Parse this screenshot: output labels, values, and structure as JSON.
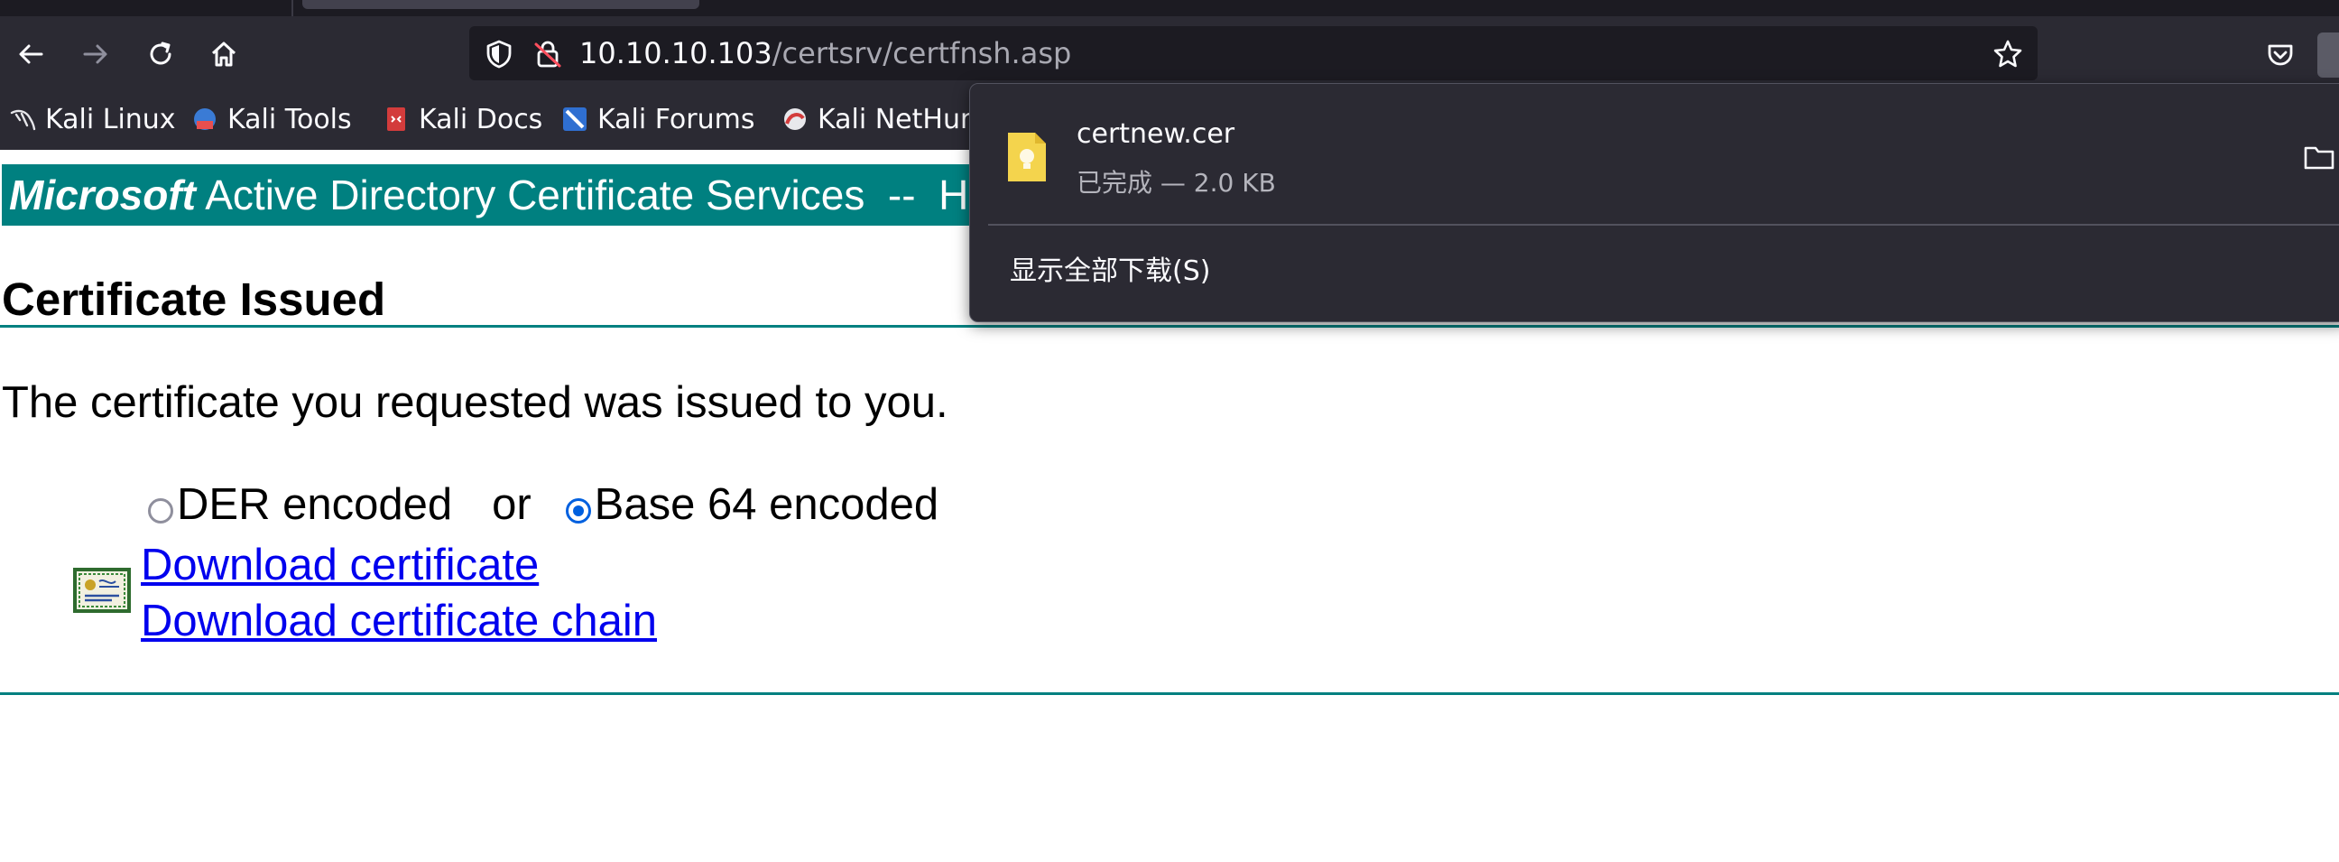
{
  "browser": {
    "url_host": "10.10.10.103",
    "url_path": "/certsrv/certfnsh.asp",
    "bookmarks": [
      {
        "label": "Kali Linux",
        "icon": "kali-dragon-icon"
      },
      {
        "label": "Kali Tools",
        "icon": "kali-tools-icon"
      },
      {
        "label": "Kali Docs",
        "icon": "kali-docs-icon"
      },
      {
        "label": "Kali Forums",
        "icon": "kali-forums-icon"
      },
      {
        "label": "Kali NetHunter",
        "icon": "kali-nethunter-icon"
      }
    ]
  },
  "downloads": {
    "file_name": "certnew.cer",
    "status": "已完成 — 2.0 KB",
    "show_all": "显示全部下载(S)"
  },
  "page": {
    "header_brand": "Microsoft",
    "header_rest": " Active Directory Certificate Services  --  H",
    "title": "Certificate Issued",
    "message": "The certificate you requested was issued to you.",
    "encoding": {
      "der_label": "DER encoded",
      "or_label": "or",
      "base64_label": "Base 64 encoded",
      "selected": "base64"
    },
    "links": {
      "download_cert": "Download certificate",
      "download_chain": "Download certificate chain"
    }
  },
  "colors": {
    "teal": "#008080",
    "link": "#0000ee",
    "chrome_dark": "#2b2a33"
  }
}
